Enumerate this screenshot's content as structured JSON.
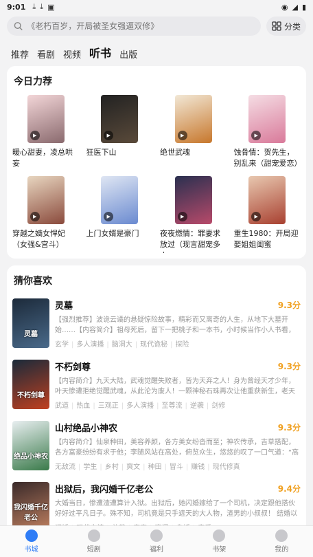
{
  "status": {
    "time": "9:01",
    "icons": [
      "download-icon",
      "download-icon",
      "app-icon"
    ],
    "right_icons": [
      "wifi-icon",
      "signal-icon",
      "battery-icon"
    ]
  },
  "search": {
    "placeholder": "《老朽百岁，开局被圣女强逼双修》",
    "classify_label": "分类"
  },
  "tabs": [
    {
      "label": "推荐",
      "active": false
    },
    {
      "label": "看剧",
      "active": false
    },
    {
      "label": "视频",
      "active": false
    },
    {
      "label": "听书",
      "active": true
    },
    {
      "label": "出版",
      "active": false
    }
  ],
  "featured": {
    "title": "今日力荐",
    "books": [
      {
        "title": "暖心甜妻，凌总哄妄",
        "cover_text": "",
        "color1": "#f3d6d8",
        "color2": "#8a6a6e"
      },
      {
        "title": "狂医下山",
        "cover_text": "",
        "color1": "#222222",
        "color2": "#5a4a3a"
      },
      {
        "title": "绝世武魂",
        "cover_text": "",
        "color1": "#f2e8d6",
        "color2": "#c7772c"
      },
      {
        "title": "蚀骨情：贺先生，别乱来（甜宠爱恋）",
        "cover_text": "",
        "color1": "#f5dde4",
        "color2": "#d97a9a"
      },
      {
        "title": "穿越之嫡女悍妃（女强&宫斗）",
        "cover_text": "",
        "color1": "#e8d6c0",
        "color2": "#8a4a3c"
      },
      {
        "title": "上门女婿是豪门",
        "cover_text": "",
        "color1": "#dfe6f3",
        "color2": "#6a8ad0"
      },
      {
        "title": "夜夜燃情：罪妻求放过（现言甜宠多人…",
        "cover_text": "",
        "color1": "#2a3050",
        "color2": "#b84a6a"
      },
      {
        "title": "重生1980：开局迎娶姐姐闺蜜",
        "cover_text": "",
        "color1": "#e8c8b0",
        "color2": "#a84030"
      }
    ]
  },
  "guess": {
    "title": "猜你喜欢",
    "items": [
      {
        "name": "灵墓",
        "score": "9.3分",
        "desc": "【强烈推荐】波诡云谲的悬疑惊险故事，精彩而又离奇的人生，从地下大墓开始……【内容简介】祖母死后，留下一把桃子和一本书，小时候当作小人书看，直到后来…",
        "tags": [
          "玄学",
          "多人演播",
          "脑洞大",
          "现代诡秘",
          "探险"
        ],
        "cover_text": "灵墓",
        "color1": "#1c2a3a",
        "color2": "#4a6a8a"
      },
      {
        "name": "不朽剑尊",
        "score": "9.3分",
        "desc": "【内容简介】九天大陆，武魂觉醒失败者，皆为天弃之人！身为曾经天才少年，叶天惨遭拒绝觉醒武魂，从此沦为废人！一颗神秘石珠再次让他重获新生，老天啊，不做…",
        "tags": [
          "武道",
          "热血",
          "三观正",
          "多人演播",
          "至尊流",
          "逆袭",
          "剑修"
        ],
        "cover_text": "不朽剑尊",
        "color1": "#1a2a3a",
        "color2": "#c04020"
      },
      {
        "name": "山村绝品小神农",
        "score": "9.3分",
        "desc": "【内容简介】仙泉种田，美容养颜，各方美女纷沓而至；神农传承，吉草搭配，各方富豪纷纷有求于他；李随风站在高处，俯览众生，悠悠的叹了一口气道：“高处不胜…",
        "tags": [
          "无敌流",
          "学生",
          "乡村",
          "爽文",
          "种田",
          "冒斗",
          "赚钱",
          "现代修真"
        ],
        "cover_text": "绝品小神农",
        "color1": "#e8eef0",
        "color2": "#3a7a4a"
      },
      {
        "name": "出狱后，我闪婚千亿老公",
        "score": "9.4分",
        "desc": "大婚当日，惨遭渣遭算计入狱。出狱后，她闪婚嫁给了一个司机，决定跟他搭伙好好过平凡日子。殊不知，司机竟是只手遮天的大人物，渣男的小叔叔！ 结婚以后…",
        "tags": [
          "闪婚",
          "现代言情",
          "总裁",
          "宠妻",
          "豪门",
          "先婚",
          "宠爱"
        ],
        "cover_text": "我闪婚千亿老公",
        "color1": "#3a2a2a",
        "color2": "#c08060"
      }
    ]
  },
  "bottom_nav": [
    {
      "label": "书城",
      "active": true,
      "icon": "book-city-icon"
    },
    {
      "label": "短剧",
      "active": false,
      "icon": "short-drama-icon"
    },
    {
      "label": "福利",
      "active": false,
      "icon": "gift-icon",
      "badge": ""
    },
    {
      "label": "书架",
      "active": false,
      "icon": "bookshelf-icon"
    },
    {
      "label": "我的",
      "active": false,
      "icon": "profile-icon"
    }
  ]
}
